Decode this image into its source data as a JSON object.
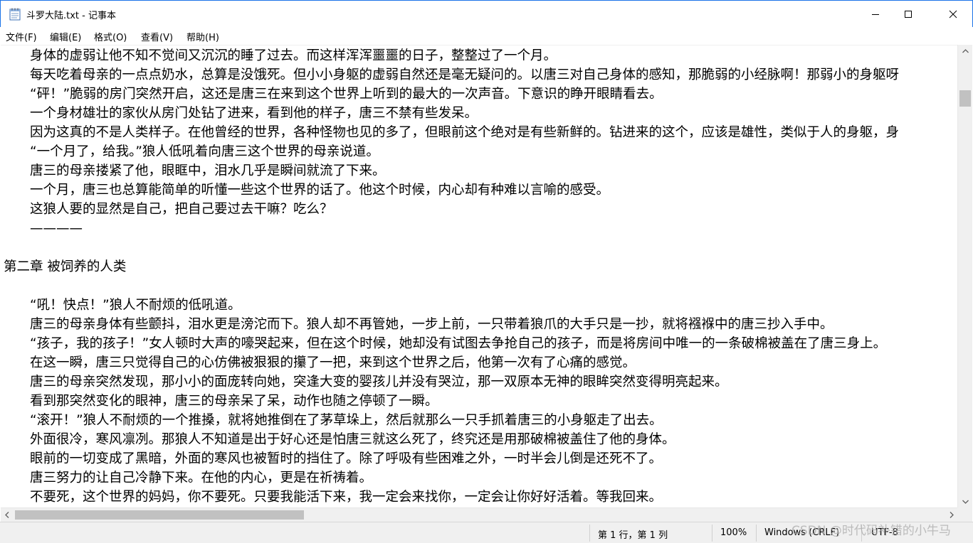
{
  "window": {
    "title": "斗罗大陆.txt - 记事本",
    "controls": {
      "minimize": "minimize",
      "maximize": "maximize",
      "close": "close"
    }
  },
  "menu": {
    "items": [
      "文件(F)",
      "编辑(E)",
      "格式(O)",
      "查看(V)",
      "帮助(H)"
    ]
  },
  "document": {
    "lines": [
      "　　身体的虚弱让他不知不觉间又沉沉的睡了过去。而这样浑浑噩噩的日子，整整过了一个月。",
      "　　每天吃着母亲的一点点奶水，总算是没饿死。但小小身躯的虚弱自然还是毫无疑问的。以唐三对自己身体的感知，那脆弱的小经脉啊！那弱小的身躯呀",
      "　　“砰！”脆弱的房门突然开启，这还是唐三在来到这个世界上听到的最大的一次声音。下意识的睁开眼睛看去。",
      "　　一个身材雄壮的家伙从房门处钻了进来，看到他的样子，唐三不禁有些发呆。",
      "　　因为这真的不是人类样子。在他曾经的世界，各种怪物也见的多了，但眼前这个绝对是有些新鲜的。钻进来的这个，应该是雄性，类似于人的身躯，身",
      "　　“一个月了，给我。”狼人低吼着向唐三这个世界的母亲说道。",
      "　　唐三的母亲搂紧了他，眼眶中，泪水几乎是瞬间就流了下来。",
      "　　一个月，唐三也总算能简单的听懂一些这个世界的话了。他这个时候，内心却有种难以言喻的感受。",
      "　　这狼人要的显然是自己，把自己要过去干嘛？吃么？",
      "　　————",
      "",
      "第二章 被饲养的人类",
      "",
      "　　“吼！快点！”狼人不耐烦的低吼道。",
      "　　唐三的母亲身体有些颤抖，泪水更是滂沱而下。狼人却不再管她，一步上前，一只带着狼爪的大手只是一抄，就将襁褓中的唐三抄入手中。",
      "　　“孩子，我的孩子！”女人顿时大声的嚎哭起来，但在这个时候，她却没有试图去争抢自己的孩子，而是将房间中唯一的一条破棉被盖在了唐三身上。",
      "　　在这一瞬，唐三只觉得自己的心仿佛被狠狠的攥了一把，来到这个世界之后，他第一次有了心痛的感觉。",
      "　　唐三的母亲突然发现，那小小的面庞转向她，突逢大变的婴孩儿并没有哭泣，那一双原本无神的眼眸突然变得明亮起来。",
      "　　看到那突然变化的眼神，唐三的母亲呆了呆，动作也随之停顿了一瞬。",
      "　　“滚开！”狼人不耐烦的一个推搡，就将她推倒在了茅草垛上，然后就那么一只手抓着唐三的小身躯走了出去。",
      "　　外面很冷，寒风凛冽。那狼人不知道是出于好心还是怕唐三就这么死了，终究还是用那破棉被盖住了他的身体。",
      "　　眼前的一切变成了黑暗，外面的寒风也被暂时的挡住了。除了呼吸有些困难之外，一时半会儿倒是还死不了。",
      "　　唐三努力的让自己冷静下来。在他的内心，更是在祈祷着。",
      "　　不要死，这个世界的妈妈，你不要死。只要我能活下来，我一定会来找你，一定会让你好好活着。等我回来。"
    ]
  },
  "status": {
    "position": "第 1 行，第 1 列",
    "zoom": "100%",
    "line_ending": "Windows (CRLF)",
    "encoding": "UTF-8"
  },
  "watermark": "CSDN @时代码补错的小牛马",
  "colors": {
    "window_border": "#1a73e8",
    "statusbar_bg": "#f0f0f0",
    "scroll_thumb": "#c1c1c1"
  }
}
